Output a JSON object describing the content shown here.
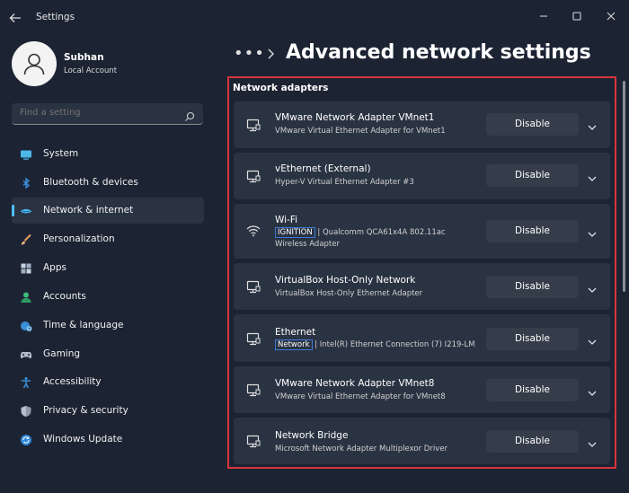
{
  "window": {
    "title": "Settings"
  },
  "profile": {
    "name": "Subhan",
    "account_type": "Local Account"
  },
  "search": {
    "placeholder": "Find a setting"
  },
  "sidebar": {
    "items": [
      {
        "label": "System",
        "icon": "monitor-icon",
        "active": false
      },
      {
        "label": "Bluetooth & devices",
        "icon": "bluetooth-icon",
        "active": false
      },
      {
        "label": "Network & internet",
        "icon": "network-icon",
        "active": true
      },
      {
        "label": "Personalization",
        "icon": "brush-icon",
        "active": false
      },
      {
        "label": "Apps",
        "icon": "apps-icon",
        "active": false
      },
      {
        "label": "Accounts",
        "icon": "person-icon",
        "active": false
      },
      {
        "label": "Time & language",
        "icon": "globe-clock-icon",
        "active": false
      },
      {
        "label": "Gaming",
        "icon": "gamepad-icon",
        "active": false
      },
      {
        "label": "Accessibility",
        "icon": "accessibility-icon",
        "active": false
      },
      {
        "label": "Privacy & security",
        "icon": "shield-icon",
        "active": false
      },
      {
        "label": "Windows Update",
        "icon": "update-icon",
        "active": false
      }
    ]
  },
  "breadcrumb": {
    "more": "•••",
    "title": "Advanced network settings"
  },
  "section": {
    "title": "Network adapters"
  },
  "adapters": [
    {
      "name": "VMware Network Adapter VMnet1",
      "description": "VMware Virtual Ethernet Adapter for VMnet1",
      "button": "Disable",
      "icon": "ethernet-icon"
    },
    {
      "name": "vEthernet (External)",
      "description": "Hyper-V Virtual Ethernet Adapter #3",
      "button": "Disable",
      "icon": "ethernet-icon"
    },
    {
      "name": "Wi-Fi",
      "tag": "IGNITION",
      "description": "| Qualcomm QCA61x4A 802.11ac",
      "description2": "Wireless Adapter",
      "button": "Disable",
      "icon": "wifi-icon"
    },
    {
      "name": "VirtualBox Host-Only Network",
      "description": "VirtualBox Host-Only Ethernet Adapter",
      "button": "Disable",
      "icon": "ethernet-icon"
    },
    {
      "name": "Ethernet",
      "tag": "Network",
      "description": "| Intel(R) Ethernet Connection (7) I219-LM",
      "button": "Disable",
      "icon": "ethernet-icon"
    },
    {
      "name": "VMware Network Adapter VMnet8",
      "description": "VMware Virtual Ethernet Adapter for VMnet8",
      "button": "Disable",
      "icon": "ethernet-icon"
    },
    {
      "name": "Network Bridge",
      "description": "Microsoft Network Adapter Multiplexor Driver",
      "button": "Disable",
      "icon": "ethernet-icon"
    }
  ],
  "colors": {
    "background": "#1c2433",
    "card": "#2a3342",
    "button": "#353d4a",
    "accent": "#4cc2ff",
    "highlight_border": "#d9343c",
    "tag_border": "#3d78d8"
  }
}
